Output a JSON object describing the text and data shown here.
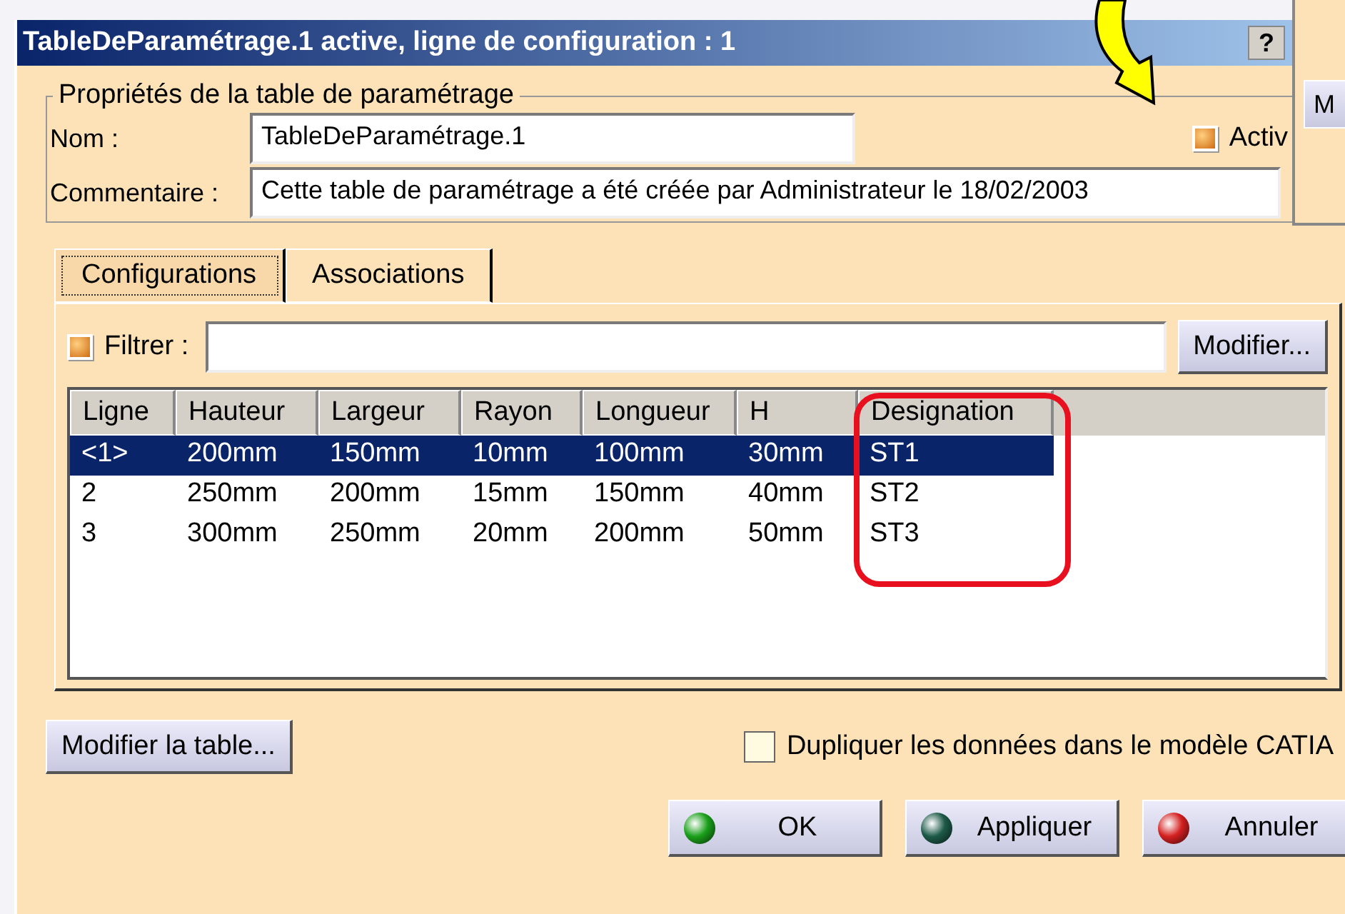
{
  "window": {
    "title": "TableDeParamétrage.1 active, ligne de configuration : 1",
    "help": "?"
  },
  "side_window": {
    "button": "M"
  },
  "properties": {
    "legend": "Propriétés de la table de paramétrage",
    "name_label": "Nom :",
    "name_value": "TableDeParamétrage.1",
    "active": {
      "label": "Activ",
      "checked": true
    },
    "comment_label": "Commentaire :",
    "comment_value": "Cette table de paramétrage a été créée par Administrateur le 18/02/2003"
  },
  "tabs": [
    {
      "label": "Configurations",
      "selected": true
    },
    {
      "label": "Associations",
      "selected": false
    }
  ],
  "filter": {
    "label": "Filtrer :",
    "checked": true,
    "button": "Modifier..."
  },
  "table": {
    "columns": [
      "Ligne",
      "Hauteur",
      "Largeur",
      "Rayon",
      "Longueur",
      "H",
      "Designation"
    ],
    "rows": [
      {
        "cells": [
          "<1>",
          "200mm",
          "150mm",
          "10mm",
          "100mm",
          "30mm",
          "ST1"
        ],
        "selected": true
      },
      {
        "cells": [
          "2",
          "250mm",
          "200mm",
          "15mm",
          "150mm",
          "40mm",
          "ST2"
        ],
        "selected": false
      },
      {
        "cells": [
          "3",
          "300mm",
          "250mm",
          "20mm",
          "200mm",
          "50mm",
          "ST3"
        ],
        "selected": false
      }
    ]
  },
  "edit_table_button": "Modifier la table...",
  "duplicate": {
    "label": "Dupliquer les données dans le modèle CATIA",
    "checked": false
  },
  "buttons": [
    {
      "label": "OK",
      "kind": "ok"
    },
    {
      "label": "Appliquer",
      "kind": "apply"
    },
    {
      "label": "Annuler",
      "kind": "cancel"
    }
  ]
}
